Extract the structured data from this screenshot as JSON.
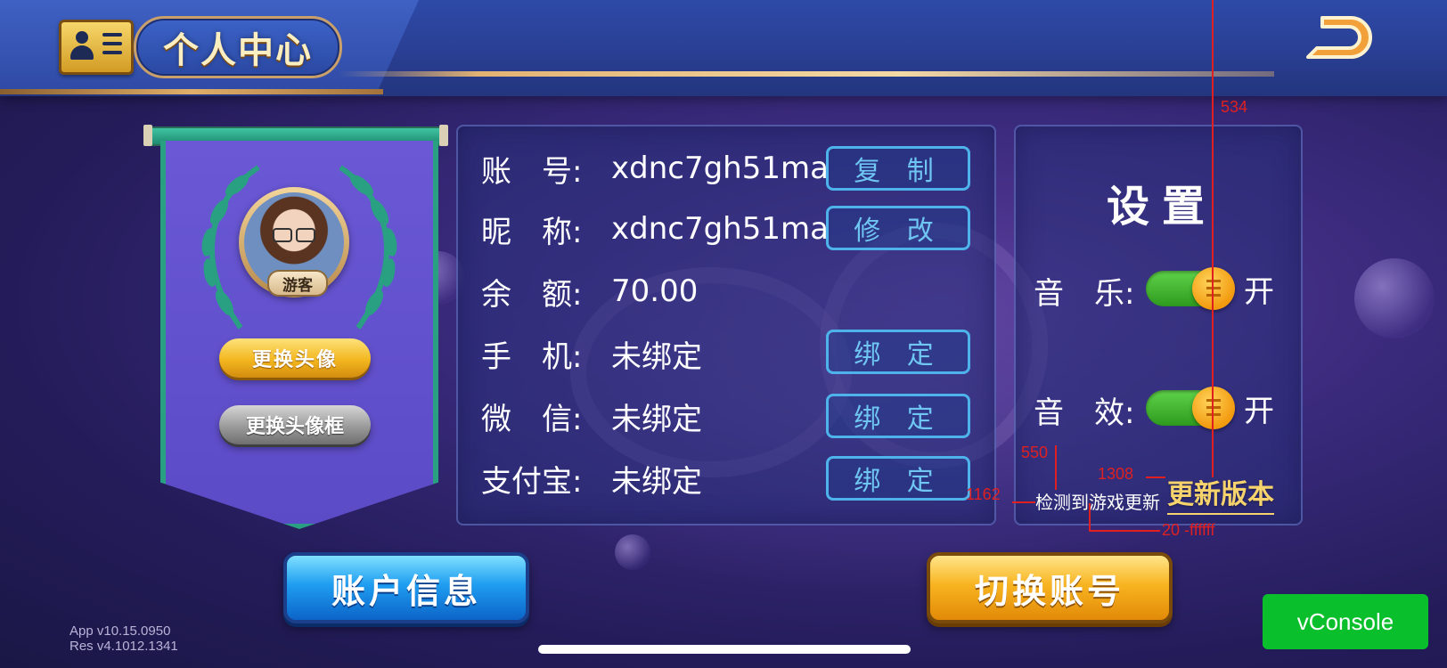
{
  "header": {
    "title": "个人中心",
    "icon": "id-card-icon",
    "back_icon": "back-arrow-icon"
  },
  "profile": {
    "guest_tag": "游客",
    "change_avatar_label": "更换头像",
    "change_frame_label": "更换头像框"
  },
  "account_info": {
    "rows": [
      {
        "label": "账　号:",
        "value": "xdnc7gh51ma",
        "action": "复 制"
      },
      {
        "label": "昵　称:",
        "value": "xdnc7gh51ma",
        "action": "修 改"
      },
      {
        "label": "余　额:",
        "value": "70.00"
      },
      {
        "label": "手　机:",
        "value": "未绑定",
        "action": "绑 定"
      },
      {
        "label": "微　信:",
        "value": "未绑定",
        "action": "绑 定"
      },
      {
        "label": "支付宝:",
        "value": "未绑定",
        "action": "绑 定"
      }
    ]
  },
  "settings": {
    "title": "设置",
    "music_label": "音　乐:",
    "music_state": "开",
    "sound_label": "音　效:",
    "sound_state": "开",
    "update_hint": "检测到游戏更新",
    "update_link": "更新版本"
  },
  "bottom_buttons": {
    "account_info_label": "账户信息",
    "switch_account_label": "切换账号"
  },
  "version": {
    "app": "App v10.15.0950",
    "res": "Res v4.1012.1341"
  },
  "vconsole_label": "vConsole",
  "annotations": {
    "a534": "534",
    "a550": "550",
    "a1308": "1308",
    "a1162": "1162",
    "a20": "20 -ffffff"
  },
  "colors": {
    "accent_blue": "#4db3ea",
    "gold": "#f6d36c",
    "toggle_on": "#2e9a1e",
    "vconsole_green": "#0abf2c",
    "annotation_red": "#e02020"
  }
}
